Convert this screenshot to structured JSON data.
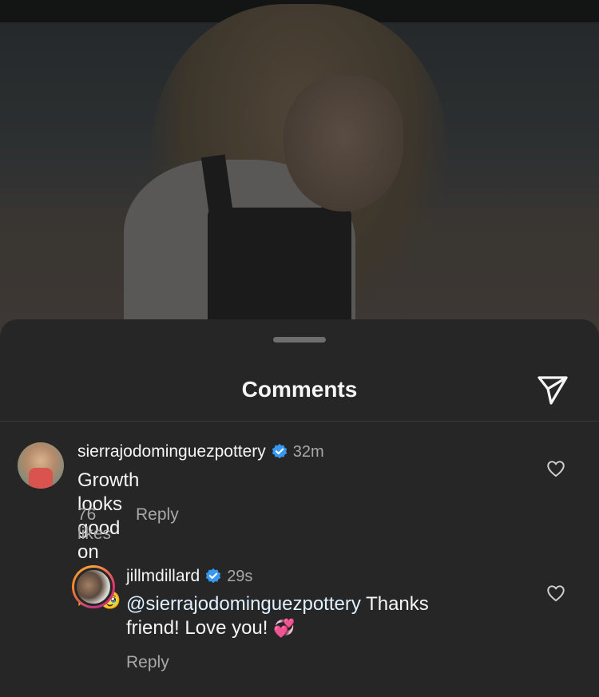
{
  "sheet": {
    "title": "Comments",
    "share_icon": "send-icon"
  },
  "comments": [
    {
      "username": "sierrajodominguezpottery",
      "verified": true,
      "time": "32m",
      "text": "Growth looks good on you.",
      "emojis": "🫶🥹",
      "likes": "76 likes",
      "reply_label": "Reply",
      "like_icon": "heart-icon"
    },
    {
      "username": "jillmdillard",
      "verified": true,
      "time": "29s",
      "mention": "@sierrajodominguezpottery",
      "text_after_mention": " Thanks",
      "text_line2": "friend! Love you!",
      "emojis": "💞",
      "reply_label": "Reply",
      "like_icon": "heart-icon",
      "story_ring": true
    }
  ],
  "colors": {
    "sheet_bg": "#262626",
    "text_primary": "#f5f5f5",
    "text_secondary": "#a8a8a8",
    "verified_blue": "#3897f0",
    "mention": "#e0f1ff"
  }
}
